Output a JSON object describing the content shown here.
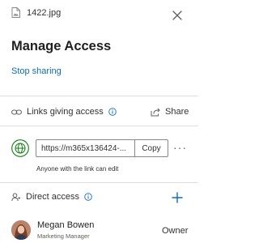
{
  "file": {
    "name": "1422.jpg",
    "icon": "image-file-icon"
  },
  "panel": {
    "title": "Manage Access",
    "stop_sharing_label": "Stop sharing",
    "close_icon": "close-icon"
  },
  "links_section": {
    "heading": "Links giving access",
    "share_label": "Share",
    "link": {
      "url_value": "https://m365x136424-...",
      "copy_label": "Copy",
      "more_label": "···",
      "caption": "Anyone with the link can edit"
    }
  },
  "direct_section": {
    "heading": "Direct access",
    "people": [
      {
        "name": "Megan Bowen",
        "role": "Marketing Manager",
        "permission": "Owner"
      }
    ]
  },
  "colors": {
    "accent": "#0f6cbd",
    "globe_green": "#107c10",
    "divider": "#e1dfdd"
  }
}
